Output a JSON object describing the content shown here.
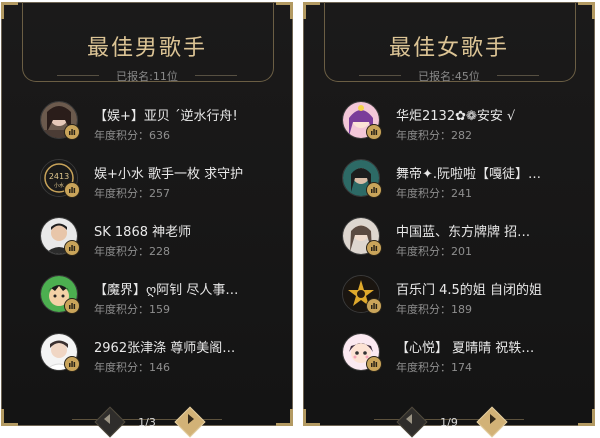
{
  "colors": {
    "gold": "#dcc495",
    "panel_bg": "#161616",
    "text": "#e8e8e8",
    "muted": "#8f8f8f"
  },
  "panels": [
    {
      "title": "最佳男歌手",
      "subtitle": "已报名:11位",
      "entries": [
        {
          "name": "【娱+】亚贝 ˊ逆水行舟!",
          "score": "年度积分：636",
          "avatar": "avatar-dark-hair"
        },
        {
          "name": "娱+小水 歌手一枚 求守护",
          "score": "年度积分：257",
          "avatar": "avatar-2413-logo"
        },
        {
          "name": "SK 1868 神老师",
          "score": "年度积分：228",
          "avatar": "avatar-man-photo"
        },
        {
          "name": "【魔界】ღ阿钊 尽人事…",
          "score": "年度积分：159",
          "avatar": "avatar-cartoon-green"
        },
        {
          "name": "2962张津涤 尊师美阁…",
          "score": "年度积分：146",
          "avatar": "avatar-white-photo"
        }
      ],
      "pager": {
        "text": "1/3"
      }
    },
    {
      "title": "最佳女歌手",
      "subtitle": "已报名:45位",
      "entries": [
        {
          "name": "华炬2132✿❁安安 √",
          "score": "年度积分：282",
          "avatar": "avatar-anime-purple"
        },
        {
          "name": "舞帝✦.阮啦啦【嘎徒】…",
          "score": "年度积分：241",
          "avatar": "avatar-teal-girl"
        },
        {
          "name": "中国蓝、东方牌牌 招…",
          "score": "年度积分：201",
          "avatar": "avatar-light-girl"
        },
        {
          "name": "百乐门 4.5的姐 自闭的姐",
          "score": "年度积分：189",
          "avatar": "avatar-dark-sparkle"
        },
        {
          "name": "【心悦】 夏晴晴 祝轶…",
          "score": "年度积分：174",
          "avatar": "avatar-cartoon-pink"
        }
      ],
      "pager": {
        "text": "1/9"
      }
    }
  ]
}
